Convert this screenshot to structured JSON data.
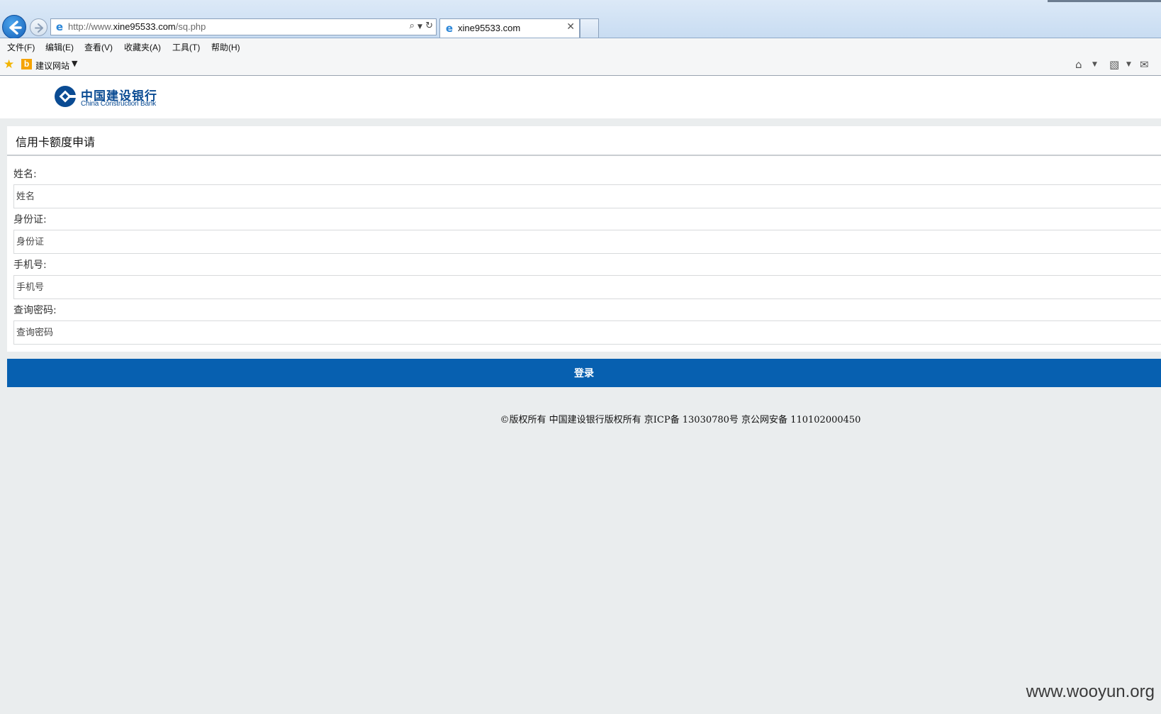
{
  "browser": {
    "url_prefix": "http://www.",
    "url_host": "xine95533.com",
    "url_path": "/sq.php",
    "tab_title": "xine95533.com",
    "menu": [
      "文件(F)",
      "编辑(E)",
      "查看(V)",
      "收藏夹(A)",
      "工具(T)",
      "帮助(H)"
    ],
    "favorites_label": "建议网站"
  },
  "logo": {
    "name_cn": "中国建设银行",
    "name_en": "China Construction Bank"
  },
  "form": {
    "title": "信用卡额度申请",
    "fields": [
      {
        "label": "姓名:",
        "placeholder": "姓名"
      },
      {
        "label": "身份证:",
        "placeholder": "身份证"
      },
      {
        "label": "手机号:",
        "placeholder": "手机号"
      },
      {
        "label": "查询密码:",
        "placeholder": "查询密码"
      }
    ],
    "submit_label": "登录"
  },
  "footer": {
    "text": "©版权所有 中国建设银行版权所有 京ICP备 13030780号 京公网安备 110102000450"
  },
  "watermark": "www.wooyun.org",
  "colors": {
    "brand_blue": "#0760b0",
    "logo_blue": "#0a4b93",
    "page_bg": "#eaedee"
  }
}
